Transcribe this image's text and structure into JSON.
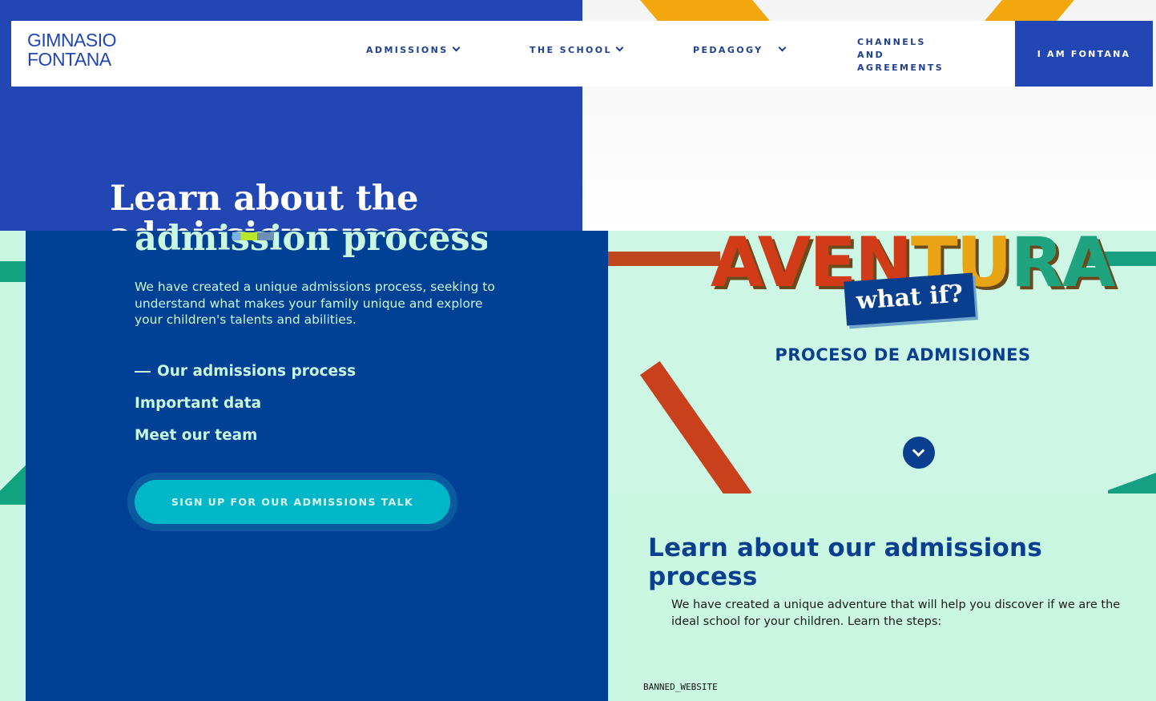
{
  "header": {
    "logo_line1": "GIMNASIO",
    "logo_line2": "FONTANA",
    "nav": [
      {
        "label": "ADMISSIONS"
      },
      {
        "label": "THE SCHOOL"
      },
      {
        "label": "PEDAGOGY"
      }
    ],
    "channels_lines": [
      "CHANNELS",
      "AND",
      "AGREEMENTS"
    ],
    "cta_label": "I AM FONTANA"
  },
  "hero": {
    "title": "Learn about the admission process",
    "description": "We have created a unique admissions process, seeking to understand what makes your family unique and explore your children's talents and abilities.",
    "links": [
      "Our admissions process",
      "Important data",
      "Meet our team"
    ],
    "cta": "SIGN UP FOR OUR ADMISSIONS TALK"
  },
  "visual": {
    "brand_parts": [
      "AVEN",
      "TU",
      "RA"
    ],
    "tagline": "what if?",
    "subtitle": "PROCESO DE ADMISIONES"
  },
  "section": {
    "title": "Learn about our admissions process",
    "description": "We have created a unique adventure that will help you discover if we are the ideal school for your children. Learn the steps:"
  },
  "footer_note": "BANNED_WEBSITE",
  "colors": {
    "brand_blue": "#2247b5",
    "navy": "#004196",
    "mint": "#c9f7e1",
    "cyan": "#00b7c9"
  }
}
